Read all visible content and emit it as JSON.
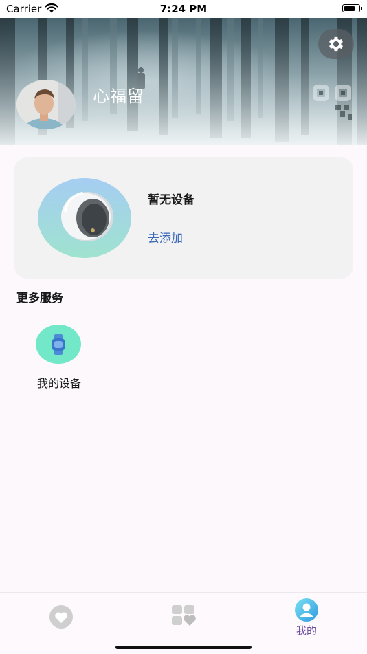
{
  "status_bar": {
    "carrier": "Carrier",
    "time": "7:24 PM"
  },
  "profile": {
    "username": "心福留"
  },
  "device_card": {
    "title": "暂无设备",
    "add_link": "去添加"
  },
  "services": {
    "title": "更多服务",
    "items": [
      {
        "label": "我的设备",
        "icon": "watch-icon"
      }
    ]
  },
  "tabbar": {
    "items": [
      {
        "label": "",
        "icon": "heart-icon",
        "active": false
      },
      {
        "label": "",
        "icon": "dashboard-heart-icon",
        "active": false
      },
      {
        "label": "我的",
        "icon": "profile-icon",
        "active": true
      }
    ]
  },
  "colors": {
    "accent": "#3a68b6",
    "tab_active": "#6a4fa0",
    "service_icon_bg": "#72e8c8",
    "card_bg": "#f3f2f3",
    "page_bg": "#fcf8fc"
  }
}
